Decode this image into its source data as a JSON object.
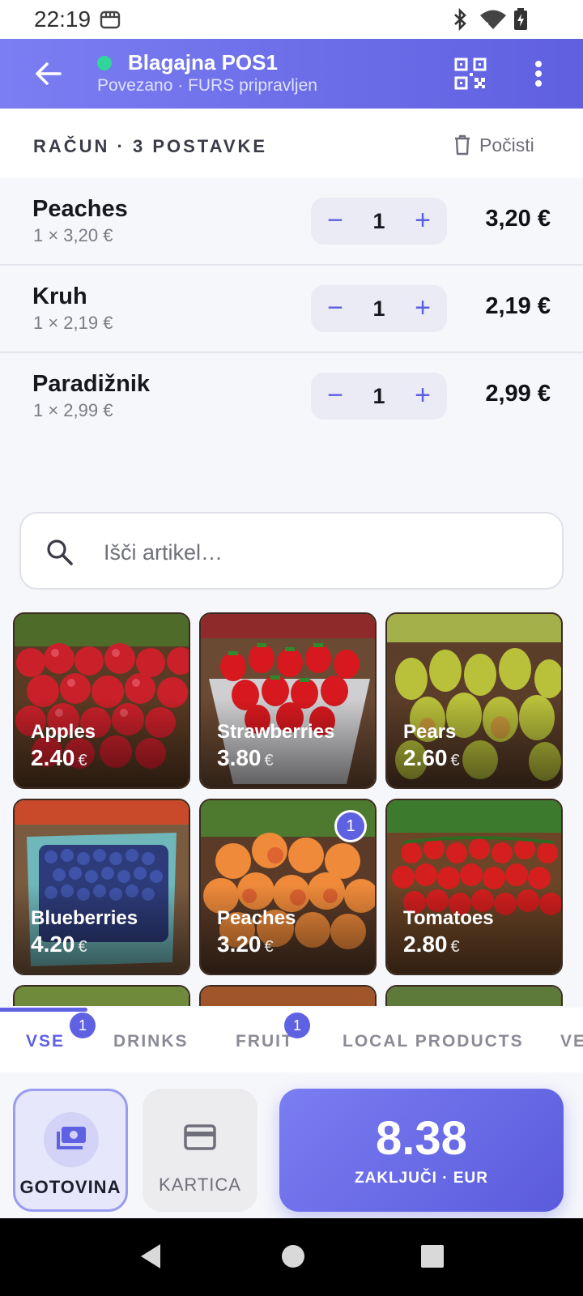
{
  "status_bar": {
    "time": "22:19"
  },
  "header": {
    "title": "Blagajna POS1",
    "subtitle": "Povezano · FURS pripravljen",
    "accent": "#6a6cec",
    "online_color": "#31d49a"
  },
  "bill": {
    "label": "RAČUN · 3 POSTAVKE",
    "clear_label": "Počisti",
    "items": [
      {
        "name": "Peaches",
        "unit": "1 × 3,20 €",
        "qty": "1",
        "total": "3,20 €",
        "minus": "−",
        "plus": "+"
      },
      {
        "name": "Kruh",
        "unit": "1 × 2,19 €",
        "qty": "1",
        "total": "2,19 €",
        "minus": "−",
        "plus": "+"
      },
      {
        "name": "Paradižnik",
        "unit": "1 × 2,99 €",
        "qty": "1",
        "total": "2,99 €",
        "minus": "−",
        "plus": "+"
      }
    ]
  },
  "search": {
    "placeholder": "Išči artikel…"
  },
  "products": [
    {
      "name": "Apples",
      "price": "2.40",
      "currency": "€",
      "icon": "apples-photo"
    },
    {
      "name": "Strawberries",
      "price": "3.80",
      "currency": "€",
      "icon": "strawberries-photo"
    },
    {
      "name": "Pears",
      "price": "2.60",
      "currency": "€",
      "icon": "pears-photo"
    },
    {
      "name": "Blueberries",
      "price": "4.20",
      "currency": "€",
      "icon": "blueberries-photo"
    },
    {
      "name": "Peaches",
      "price": "3.20",
      "currency": "€",
      "icon": "peaches-photo",
      "badge": "1"
    },
    {
      "name": "Tomatoes",
      "price": "2.80",
      "currency": "€",
      "icon": "tomatoes-photo"
    }
  ],
  "categories": [
    {
      "label": "VSE",
      "badge": "1",
      "active": true
    },
    {
      "label": "DRINKS"
    },
    {
      "label": "FRUIT",
      "badge": "1"
    },
    {
      "label": "LOCAL PRODUCTS"
    },
    {
      "label": "VE"
    }
  ],
  "payment": {
    "cash_label": "GOTOVINA",
    "card_label": "KARTICA",
    "selected": "cash"
  },
  "checkout": {
    "amount": "8.38",
    "label": "ZAKLJUČI · EUR"
  }
}
